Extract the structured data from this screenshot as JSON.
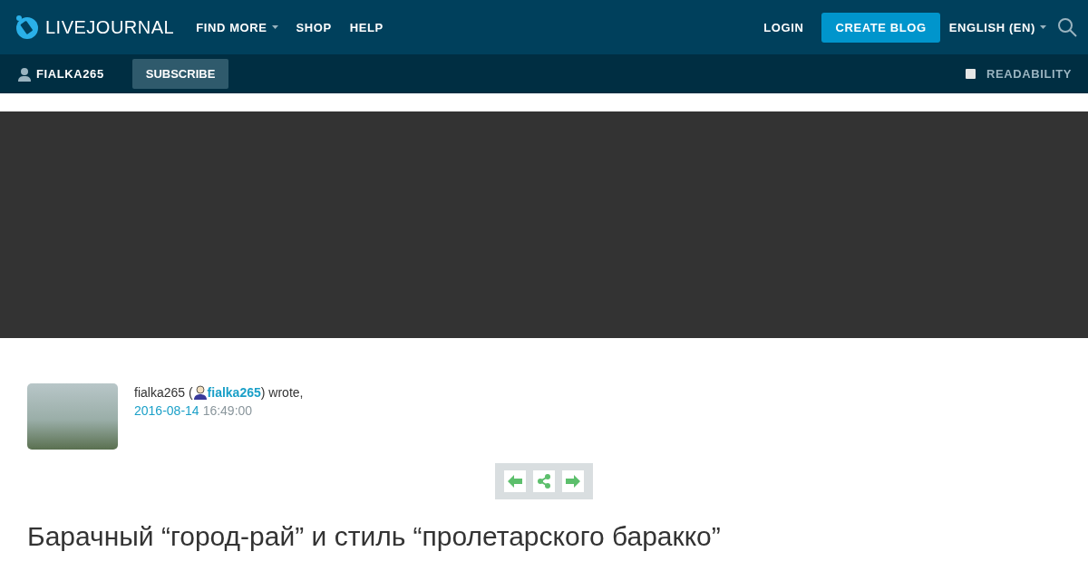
{
  "header": {
    "logo": "LIVEJOURNAL",
    "nav": [
      {
        "label": "FIND MORE",
        "dropdown": true
      },
      {
        "label": "SHOP",
        "dropdown": false
      },
      {
        "label": "HELP",
        "dropdown": false
      }
    ],
    "login": "LOGIN",
    "create": "CREATE BLOG",
    "language": "ENGLISH (EN)"
  },
  "subbar": {
    "user": "FIALKA265",
    "subscribe": "SUBSCRIBE",
    "readability": {
      "label": "READABILITY",
      "checked": false
    }
  },
  "post": {
    "author_before": "fialka265 (",
    "author_link": "fialka265",
    "author_after": ") wrote,",
    "date": "2016-08-14",
    "time": "16:49:00",
    "title": "Барачный “город-рай” и стиль “пролетарского баракко”"
  }
}
